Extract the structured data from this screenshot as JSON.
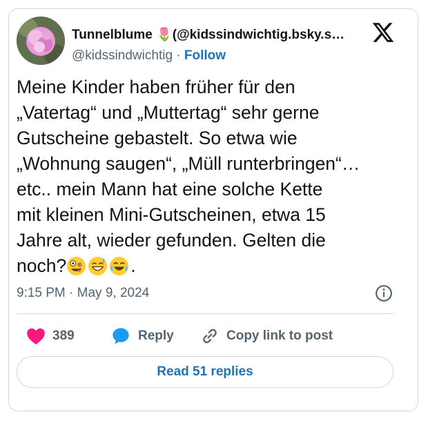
{
  "author": {
    "display_name": "Tunnelblume 🌷(@kidssindwichtig.bsky.s…",
    "handle": "@kidssindwichtig",
    "separator": "·",
    "follow_label": "Follow"
  },
  "tweet": {
    "lines": [
      "Meine Kinder haben früher für den",
      "„Vatertag“ und „Muttertag“ sehr gerne",
      "Gutscheine gebastelt. So etwa wie",
      "„Wohnung saugen“, „Müll runterbringen“…",
      "etc.. mein Mann hat eine solche Kette",
      "mit kleinen Mini-Gutscheinen, etwa 15",
      "Jahre alt, wieder gefunden. Gelten die"
    ],
    "last_line_prefix": "noch?",
    "last_line_suffix": ".",
    "emojis": [
      "zany-face",
      "grinning-sweat-face",
      "tears-of-joy-face"
    ]
  },
  "meta": {
    "timestamp": "9:15 PM · May 9, 2024"
  },
  "actions": {
    "like_count": "389",
    "reply_label": "Reply",
    "copy_label": "Copy link to post"
  },
  "read_replies_label": "Read 51 replies",
  "colors": {
    "link_blue": "#1d72b8",
    "like_pink": "#f91880",
    "reply_blue": "#1d9bf0",
    "secondary_text": "#536471",
    "border": "#cfd9de"
  }
}
